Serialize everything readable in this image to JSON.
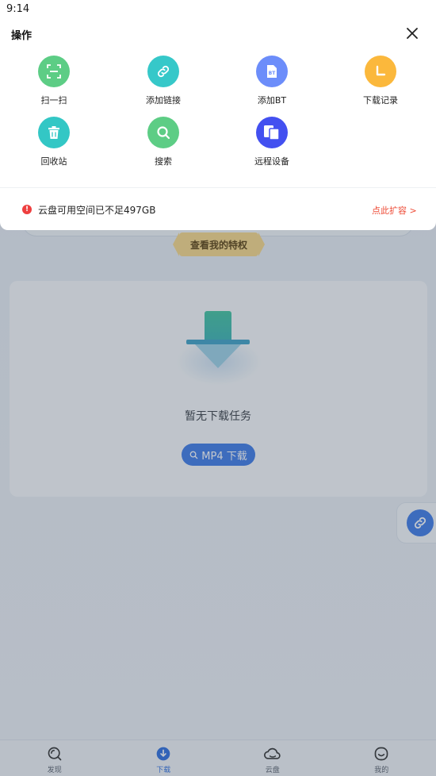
{
  "status_bar": {
    "time": "9:14"
  },
  "sheet": {
    "title": "操作",
    "actions": [
      {
        "label": "扫一扫",
        "icon": "scan-icon",
        "color": "#5dcd85"
      },
      {
        "label": "添加链接",
        "icon": "link-icon",
        "color": "#36c8c9"
      },
      {
        "label": "添加BT",
        "icon": "bt-file-icon",
        "color": "#6c8dfa"
      },
      {
        "label": "下载记录",
        "icon": "clock-icon",
        "color": "#fbb83c"
      },
      {
        "label": "回收站",
        "icon": "trash-icon",
        "color": "#33c7c5"
      },
      {
        "label": "搜索",
        "icon": "search-icon",
        "color": "#5dcd85"
      },
      {
        "label": "远程设备",
        "icon": "devices-icon",
        "color": "#4350f0"
      }
    ],
    "bt_badge": "BT",
    "warning": {
      "text": "云盘可用空间已不足497GB",
      "link": "点此扩容 >",
      "mark": "!"
    }
  },
  "background": {
    "privilege_label": "查看我的特权",
    "empty_text": "暂无下载任务",
    "mp4_button": "MP4 下载"
  },
  "bottom_nav": [
    {
      "label": "发现",
      "icon": "discover-icon",
      "active": false
    },
    {
      "label": "下载",
      "icon": "download-icon",
      "active": true
    },
    {
      "label": "云盘",
      "icon": "cloud-icon",
      "active": false
    },
    {
      "label": "我的",
      "icon": "profile-icon",
      "active": false
    }
  ],
  "colors": {
    "accent": "#3e7be8",
    "warning": "#ee3f3f",
    "link_red": "#ee4a35"
  }
}
